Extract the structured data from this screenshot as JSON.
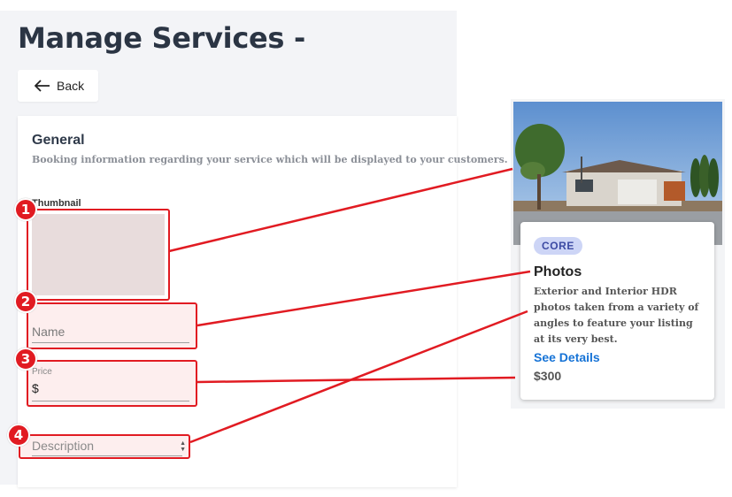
{
  "page": {
    "title": "Manage Services -",
    "back_label": "Back"
  },
  "general": {
    "title": "General",
    "description": "Booking information regarding your service which will be displayed to your customers.",
    "thumbnail_label": "Thumbnail",
    "name_placeholder": "Name",
    "price_label": "Price",
    "price_value": "$",
    "description_placeholder": "Description"
  },
  "preview": {
    "badge": "CORE",
    "title": "Photos",
    "description": "Exterior and Interior HDR photos taken from a variety of angles to feature your listing at its very best.",
    "link": "See Details",
    "price": "$300"
  },
  "annotations": {
    "markers": [
      "1",
      "2",
      "3",
      "4"
    ],
    "color": "#e11b22"
  }
}
